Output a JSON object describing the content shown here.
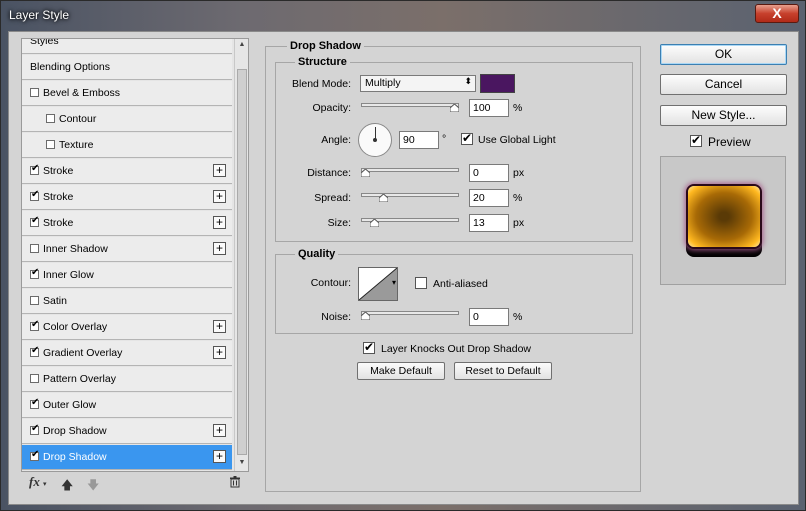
{
  "window": {
    "title": "Layer Style",
    "close_label": "X"
  },
  "style_list": {
    "items": [
      {
        "label": "Styles",
        "checkbox": false,
        "checked": false,
        "plus": false,
        "indent": false,
        "selected": false
      },
      {
        "label": "Blending Options",
        "checkbox": false,
        "checked": false,
        "plus": false,
        "indent": false,
        "selected": false
      },
      {
        "label": "Bevel & Emboss",
        "checkbox": true,
        "checked": false,
        "plus": false,
        "indent": false,
        "selected": false
      },
      {
        "label": "Contour",
        "checkbox": true,
        "checked": false,
        "plus": false,
        "indent": true,
        "selected": false
      },
      {
        "label": "Texture",
        "checkbox": true,
        "checked": false,
        "plus": false,
        "indent": true,
        "selected": false
      },
      {
        "label": "Stroke",
        "checkbox": true,
        "checked": true,
        "plus": true,
        "indent": false,
        "selected": false
      },
      {
        "label": "Stroke",
        "checkbox": true,
        "checked": true,
        "plus": true,
        "indent": false,
        "selected": false
      },
      {
        "label": "Stroke",
        "checkbox": true,
        "checked": true,
        "plus": true,
        "indent": false,
        "selected": false
      },
      {
        "label": "Inner Shadow",
        "checkbox": true,
        "checked": false,
        "plus": true,
        "indent": false,
        "selected": false
      },
      {
        "label": "Inner Glow",
        "checkbox": true,
        "checked": true,
        "plus": false,
        "indent": false,
        "selected": false
      },
      {
        "label": "Satin",
        "checkbox": true,
        "checked": false,
        "plus": false,
        "indent": false,
        "selected": false
      },
      {
        "label": "Color Overlay",
        "checkbox": true,
        "checked": true,
        "plus": true,
        "indent": false,
        "selected": false
      },
      {
        "label": "Gradient Overlay",
        "checkbox": true,
        "checked": true,
        "plus": true,
        "indent": false,
        "selected": false
      },
      {
        "label": "Pattern Overlay",
        "checkbox": true,
        "checked": false,
        "plus": false,
        "indent": false,
        "selected": false
      },
      {
        "label": "Outer Glow",
        "checkbox": true,
        "checked": true,
        "plus": false,
        "indent": false,
        "selected": false
      },
      {
        "label": "Drop Shadow",
        "checkbox": true,
        "checked": true,
        "plus": true,
        "indent": false,
        "selected": false
      },
      {
        "label": "Drop Shadow",
        "checkbox": true,
        "checked": true,
        "plus": true,
        "indent": false,
        "selected": true
      }
    ],
    "toolbar": {
      "fx_label": "fx",
      "plus_symbol": "+"
    }
  },
  "drop_shadow": {
    "title": "Drop Shadow",
    "structure": {
      "title": "Structure",
      "blend_mode_label": "Blend Mode:",
      "blend_mode_value": "Multiply",
      "shadow_color": "#4a1660",
      "opacity_label": "Opacity:",
      "opacity_value": "100",
      "opacity_fraction": 1.0,
      "opacity_unit": "%",
      "angle_label": "Angle:",
      "angle_value": "90",
      "angle_unit": "°",
      "use_global_light_label": "Use Global Light",
      "use_global_light_checked": true,
      "distance_label": "Distance:",
      "distance_value": "0",
      "distance_fraction": 0.0,
      "distance_unit": "px",
      "spread_label": "Spread:",
      "spread_value": "20",
      "spread_fraction": 0.2,
      "spread_unit": "%",
      "size_label": "Size:",
      "size_value": "13",
      "size_fraction": 0.1,
      "size_unit": "px"
    },
    "quality": {
      "title": "Quality",
      "contour_label": "Contour:",
      "anti_aliased_label": "Anti-aliased",
      "anti_aliased_checked": false,
      "noise_label": "Noise:",
      "noise_value": "0",
      "noise_fraction": 0.0,
      "noise_unit": "%"
    },
    "knocks_out_label": "Layer Knocks Out Drop Shadow",
    "knocks_out_checked": true,
    "make_default_label": "Make Default",
    "reset_default_label": "Reset to Default"
  },
  "actions": {
    "ok_label": "OK",
    "cancel_label": "Cancel",
    "new_style_label": "New Style...",
    "preview_label": "Preview",
    "preview_checked": true
  }
}
